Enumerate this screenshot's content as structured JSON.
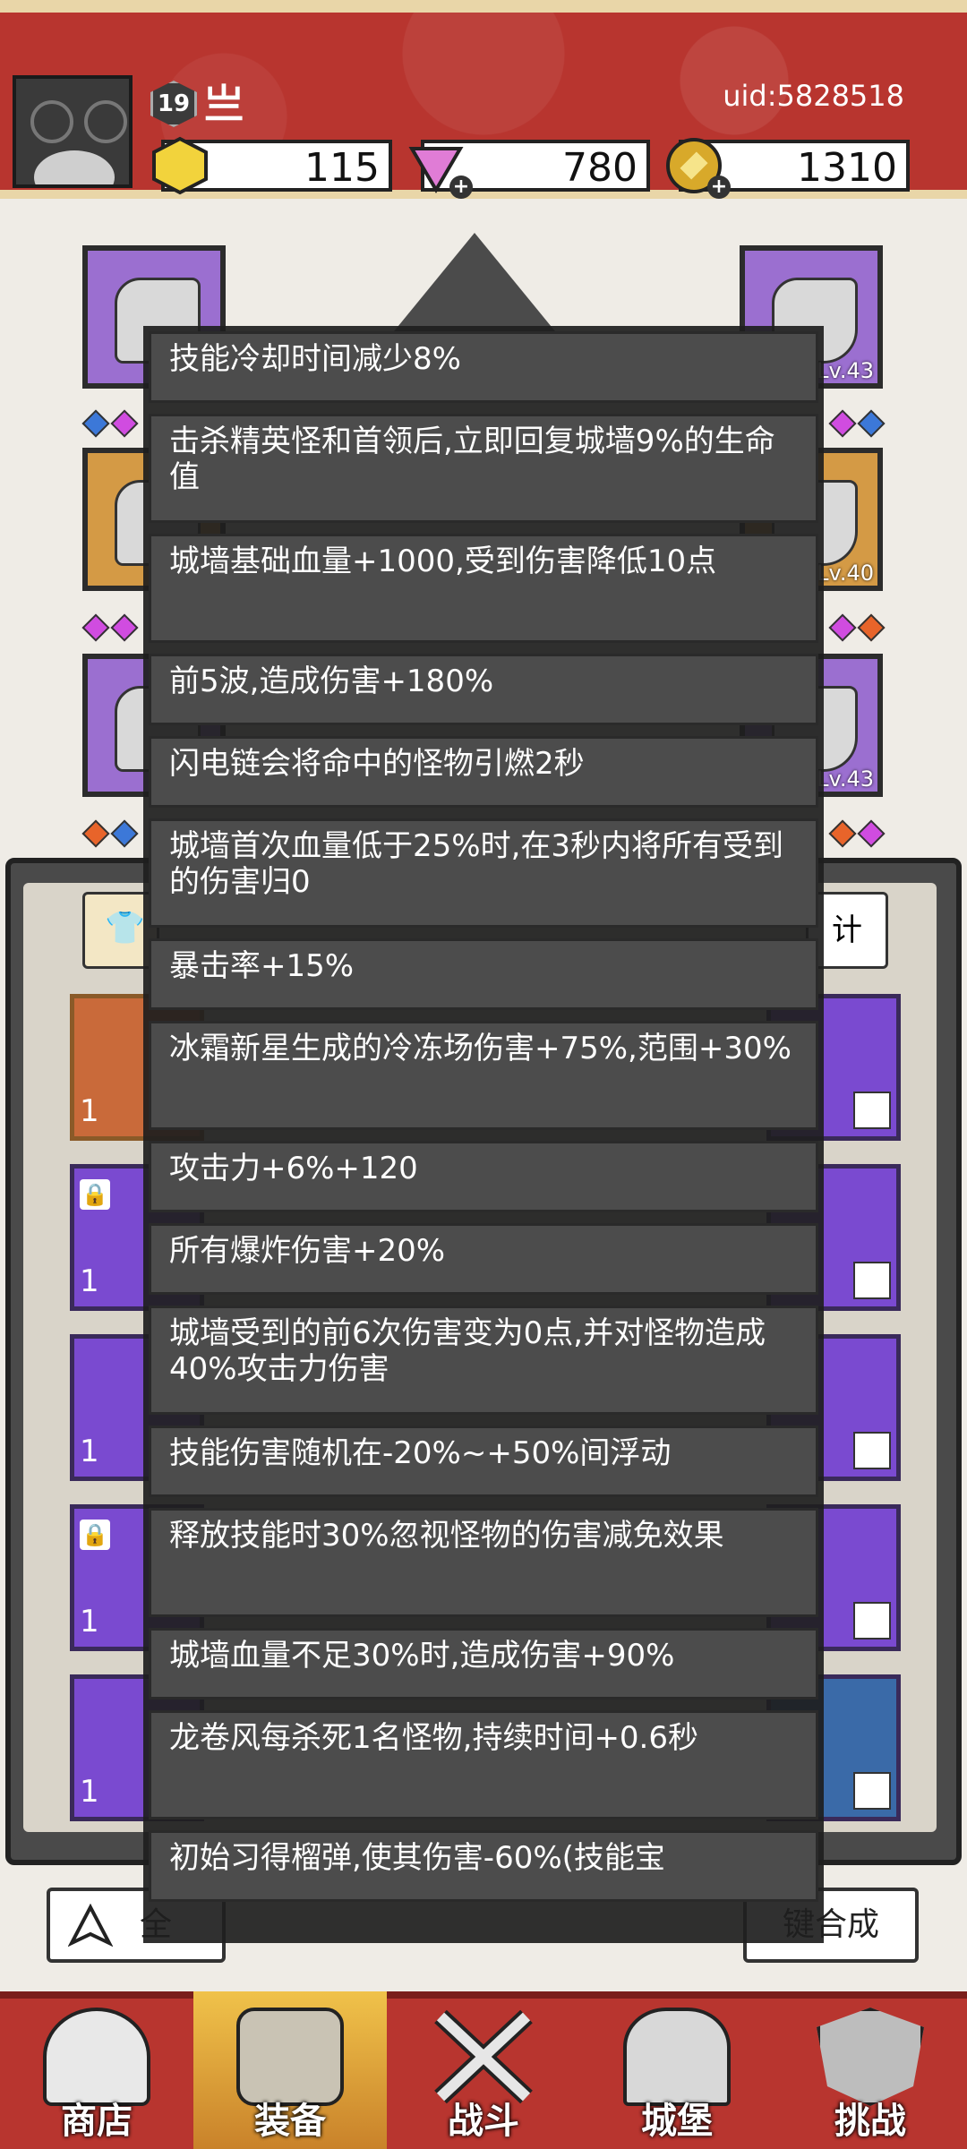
{
  "header": {
    "level": "19",
    "player_name": "亗",
    "uid": "uid:5828518",
    "resources": [
      {
        "name": "gold-hex",
        "value": "115",
        "color": "#f2d33c"
      },
      {
        "name": "diamond",
        "value": "780",
        "color": "#e07cd6"
      },
      {
        "name": "coin",
        "value": "1310",
        "color": "#d8a92a"
      }
    ]
  },
  "equipment_levels": {
    "top_right": "Lv.43",
    "mid_right": "Lv.40",
    "low_right": "Lv.43"
  },
  "tooltip": {
    "effects": [
      "技能冷却时间减少8%",
      "击杀精英怪和首领后,立即回复城墙9%的生命值",
      "城墙基础血量+1000,受到伤害降低10点",
      "前5波,造成伤害+180%",
      "闪电链会将命中的怪物引燃2秒",
      "城墙首次血量低于25%时,在3秒内将所有受到的伤害归0",
      "暴击率+15%",
      "冰霜新星生成的冷冻场伤害+75%,范围+30%",
      "攻击力+6%+120",
      "所有爆炸伤害+20%",
      "城墙受到的前6次伤害变为0点,并对怪物造成40%攻击力伤害",
      "技能伤害随机在-20%~+50%间浮动",
      "释放技能时30%忽视怪物的伤害减免效果",
      "城墙血量不足30%时,造成伤害+90%",
      "龙卷风每杀死1名怪物,持续时间+0.6秒",
      "初始习得榴弹,使其伤害-60%(技能宝"
    ]
  },
  "panel": {
    "card_count": "1",
    "stats_button_label": "计",
    "bottom_left_label": "全",
    "bottom_right_label": "键合成"
  },
  "tabs": [
    {
      "label": "商店",
      "active": false
    },
    {
      "label": "装备",
      "active": true
    },
    {
      "label": "战斗",
      "active": false
    },
    {
      "label": "城堡",
      "active": false
    },
    {
      "label": "挑战",
      "active": false
    }
  ]
}
